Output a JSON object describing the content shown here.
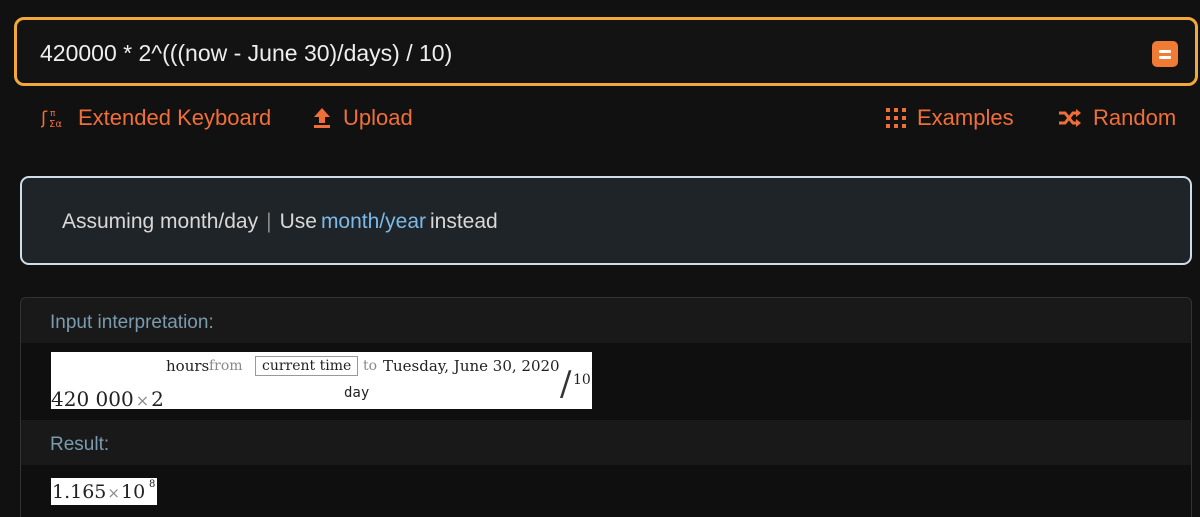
{
  "query": {
    "value": "420000 * 2^(((now - June 30)/days) / 10)"
  },
  "toolbar": {
    "extended_keyboard": "Extended Keyboard",
    "upload": "Upload",
    "examples": "Examples",
    "random": "Random"
  },
  "assumption": {
    "prefix": "Assuming month/day",
    "separator": "|",
    "use": "Use",
    "link": "month/year",
    "suffix": "instead"
  },
  "pods": {
    "input_title": "Input interpretation:",
    "result_title": "Result:"
  },
  "interpretation": {
    "base": "420 000",
    "times": "×",
    "two": "2",
    "hours": "hours",
    "from": "from",
    "current_time": "current time",
    "to": "to",
    "date": "Tuesday, June 30, 2020",
    "day": "day",
    "divisor": "10"
  },
  "result": {
    "mantissa": "1.165",
    "times": "×",
    "base": "10",
    "exponent": "8"
  },
  "colors": {
    "accent": "#f06f38",
    "query_border": "#f0a93a",
    "link": "#7cb9e8",
    "pod_title": "#7a9bb0"
  },
  "icons": [
    "equals-icon",
    "extended-keyboard-icon",
    "upload-icon",
    "examples-grid-icon",
    "random-shuffle-icon"
  ]
}
